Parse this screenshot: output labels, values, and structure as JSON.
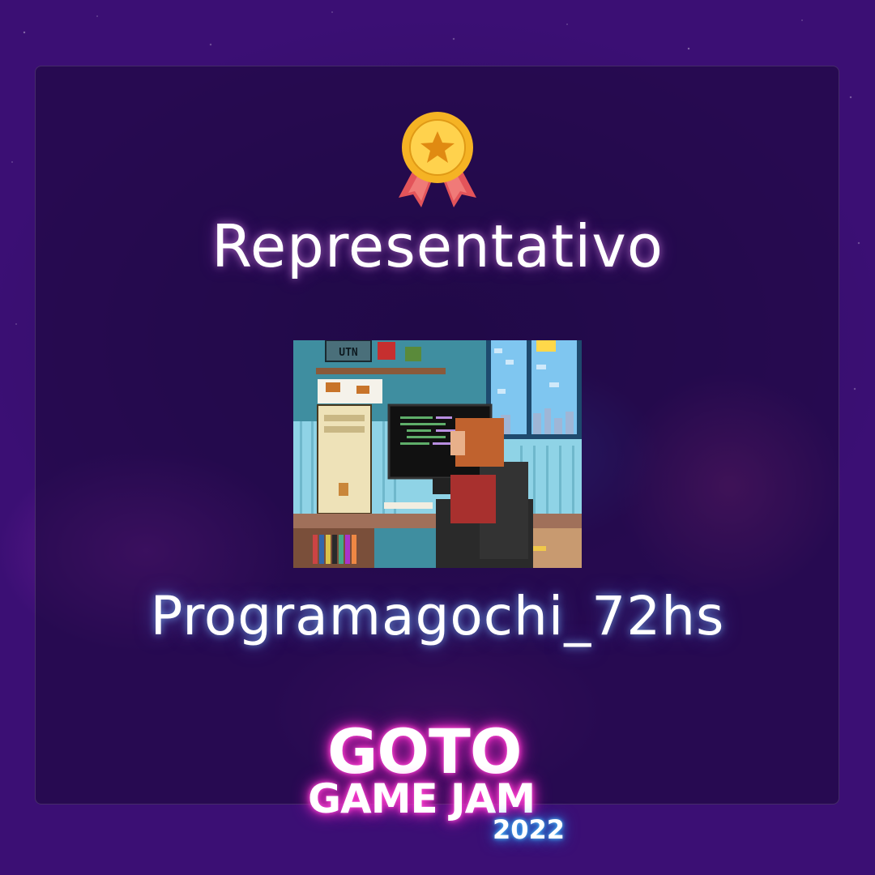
{
  "award": {
    "title": "Representativo",
    "icon": "medal-icon"
  },
  "game": {
    "name": "Programagochi_72hs",
    "screenshot_label": "UTN"
  },
  "event_logo": {
    "line1": "GOTO",
    "line2": "GAME JAM",
    "year": "2022"
  },
  "colors": {
    "background": "#3a0e6e",
    "panel": "#1c083c",
    "title_glow": "#ffaaff",
    "name_glow": "#82beff",
    "logo_pink": "#ff2fc8",
    "logo_blue": "#2f9cff",
    "medal_gold": "#f5b324",
    "ribbon": "#e3545a"
  }
}
